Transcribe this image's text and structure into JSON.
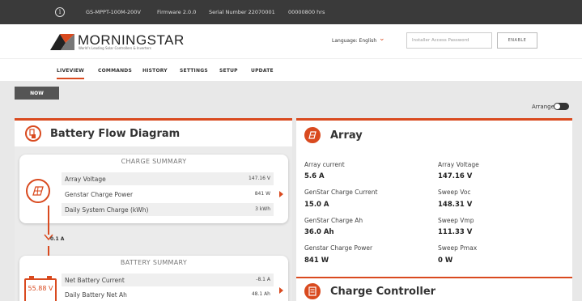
{
  "topbar": {
    "model": "GS-MPPT-100M-200V",
    "firmware": "Firmware 2.0.0",
    "serial": "Serial Number 22070001",
    "hours": "00000800 hrs"
  },
  "header": {
    "logo_text": "MORNINGSTAR",
    "logo_tagline": "World's Leading Solar Controllers & Inverters",
    "language": "Language: English",
    "password_placeholder": "Installer Access Password",
    "enable_label": "ENABLE"
  },
  "nav": {
    "tabs": [
      {
        "label": "LIVEVIEW"
      },
      {
        "label": "COMMANDS"
      },
      {
        "label": "HISTORY"
      },
      {
        "label": "SETTINGS"
      },
      {
        "label": "SETUP"
      },
      {
        "label": "UPDATE"
      }
    ]
  },
  "controls": {
    "now_label": "NOW",
    "arrange_label": "Arrange"
  },
  "battery_flow": {
    "title": "Battery Flow Diagram",
    "charge_summary": {
      "title": "CHARGE SUMMARY",
      "rows": [
        {
          "label": "Array Voltage",
          "value": "147.16 V"
        },
        {
          "label": "Genstar Charge Power",
          "value": "841 W"
        },
        {
          "label": "Daily System Charge (kWh)",
          "value": "3 kWh"
        }
      ]
    },
    "flow_current": "0.1 A",
    "battery_summary": {
      "title": "BATTERY SUMMARY",
      "battery_voltage": "55.88 V",
      "rows": [
        {
          "label": "Net Battery Current",
          "value": "-8.1 A"
        },
        {
          "label": "Daily Battery Net Ah",
          "value": "48.1 Ah"
        }
      ]
    }
  },
  "array_panel": {
    "title": "Array",
    "fields": [
      {
        "label": "Array current",
        "value": "5.6 A"
      },
      {
        "label": "Array Voltage",
        "value": "147.16 V"
      },
      {
        "label": "GenStar Charge Current",
        "value": "15.0 A"
      },
      {
        "label": "Sweep Voc",
        "value": "148.31 V"
      },
      {
        "label": "GenStar Charge Ah",
        "value": "36.0 Ah"
      },
      {
        "label": "Sweep Vmp",
        "value": "111.33 V"
      },
      {
        "label": "Genstar Charge Power",
        "value": "841 W"
      },
      {
        "label": "Sweep Pmax",
        "value": "0 W"
      }
    ]
  },
  "charge_controller_panel": {
    "title": "Charge Controller"
  },
  "colors": {
    "accent": "#d94a1f",
    "topbar_bg": "#3a3a3a",
    "page_bg": "#e8e8e8"
  }
}
